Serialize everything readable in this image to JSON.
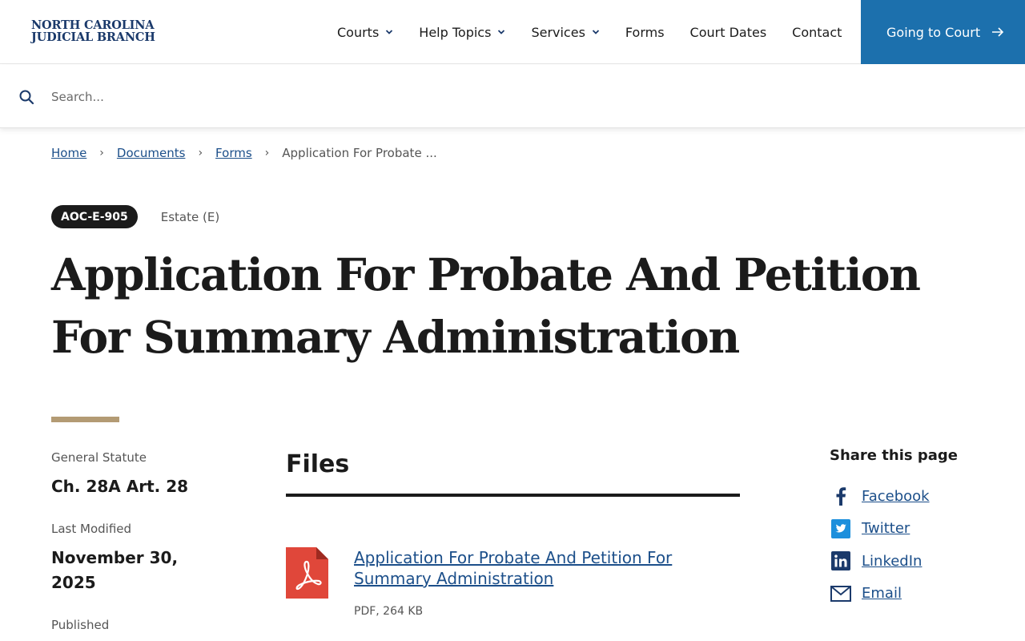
{
  "header": {
    "logo_line1": "NORTH CAROLINA",
    "logo_line2": "JUDICIAL BRANCH",
    "nav": [
      {
        "label": "Courts",
        "has_dropdown": true
      },
      {
        "label": "Help Topics",
        "has_dropdown": true
      },
      {
        "label": "Services",
        "has_dropdown": true
      },
      {
        "label": "Forms",
        "has_dropdown": false
      },
      {
        "label": "Court Dates",
        "has_dropdown": false
      },
      {
        "label": "Contact",
        "has_dropdown": false
      }
    ],
    "cta_label": "Going to Court",
    "cta_icon": "arrow-right-icon"
  },
  "search": {
    "placeholder": "Search...",
    "value": "",
    "icon": "search-icon"
  },
  "breadcrumb": {
    "items": [
      "Home",
      "Documents",
      "Forms"
    ],
    "current": "Application For Probate ..."
  },
  "form": {
    "code": "AOC-E-905",
    "category": "Estate (E)",
    "title": "Application For Probate And Petition For Summary Administration"
  },
  "meta": {
    "statute_label": "General Statute",
    "statute_value": "Ch. 28A Art. 28",
    "modified_label": "Last Modified",
    "modified_value": "November 30, 2025",
    "published_label": "Published"
  },
  "files": {
    "heading": "Files",
    "items": [
      {
        "title": "Application For Probate And Petition For Summary Administration ",
        "info": "PDF, 264 KB",
        "icon": "pdf-file-icon"
      }
    ]
  },
  "share": {
    "title": "Share this page",
    "items": [
      {
        "label": "Facebook",
        "icon": "facebook-icon"
      },
      {
        "label": "Twitter",
        "icon": "twitter-icon"
      },
      {
        "label": "LinkedIn",
        "icon": "linkedin-icon"
      },
      {
        "label": "Email",
        "icon": "email-icon"
      }
    ]
  },
  "colors": {
    "brand_navy": "#1b3a6b",
    "cta_blue": "#1c70ad",
    "link_blue": "#1c4f8a",
    "accent_tan": "#b39b74",
    "pdf_red": "#e0473a"
  }
}
